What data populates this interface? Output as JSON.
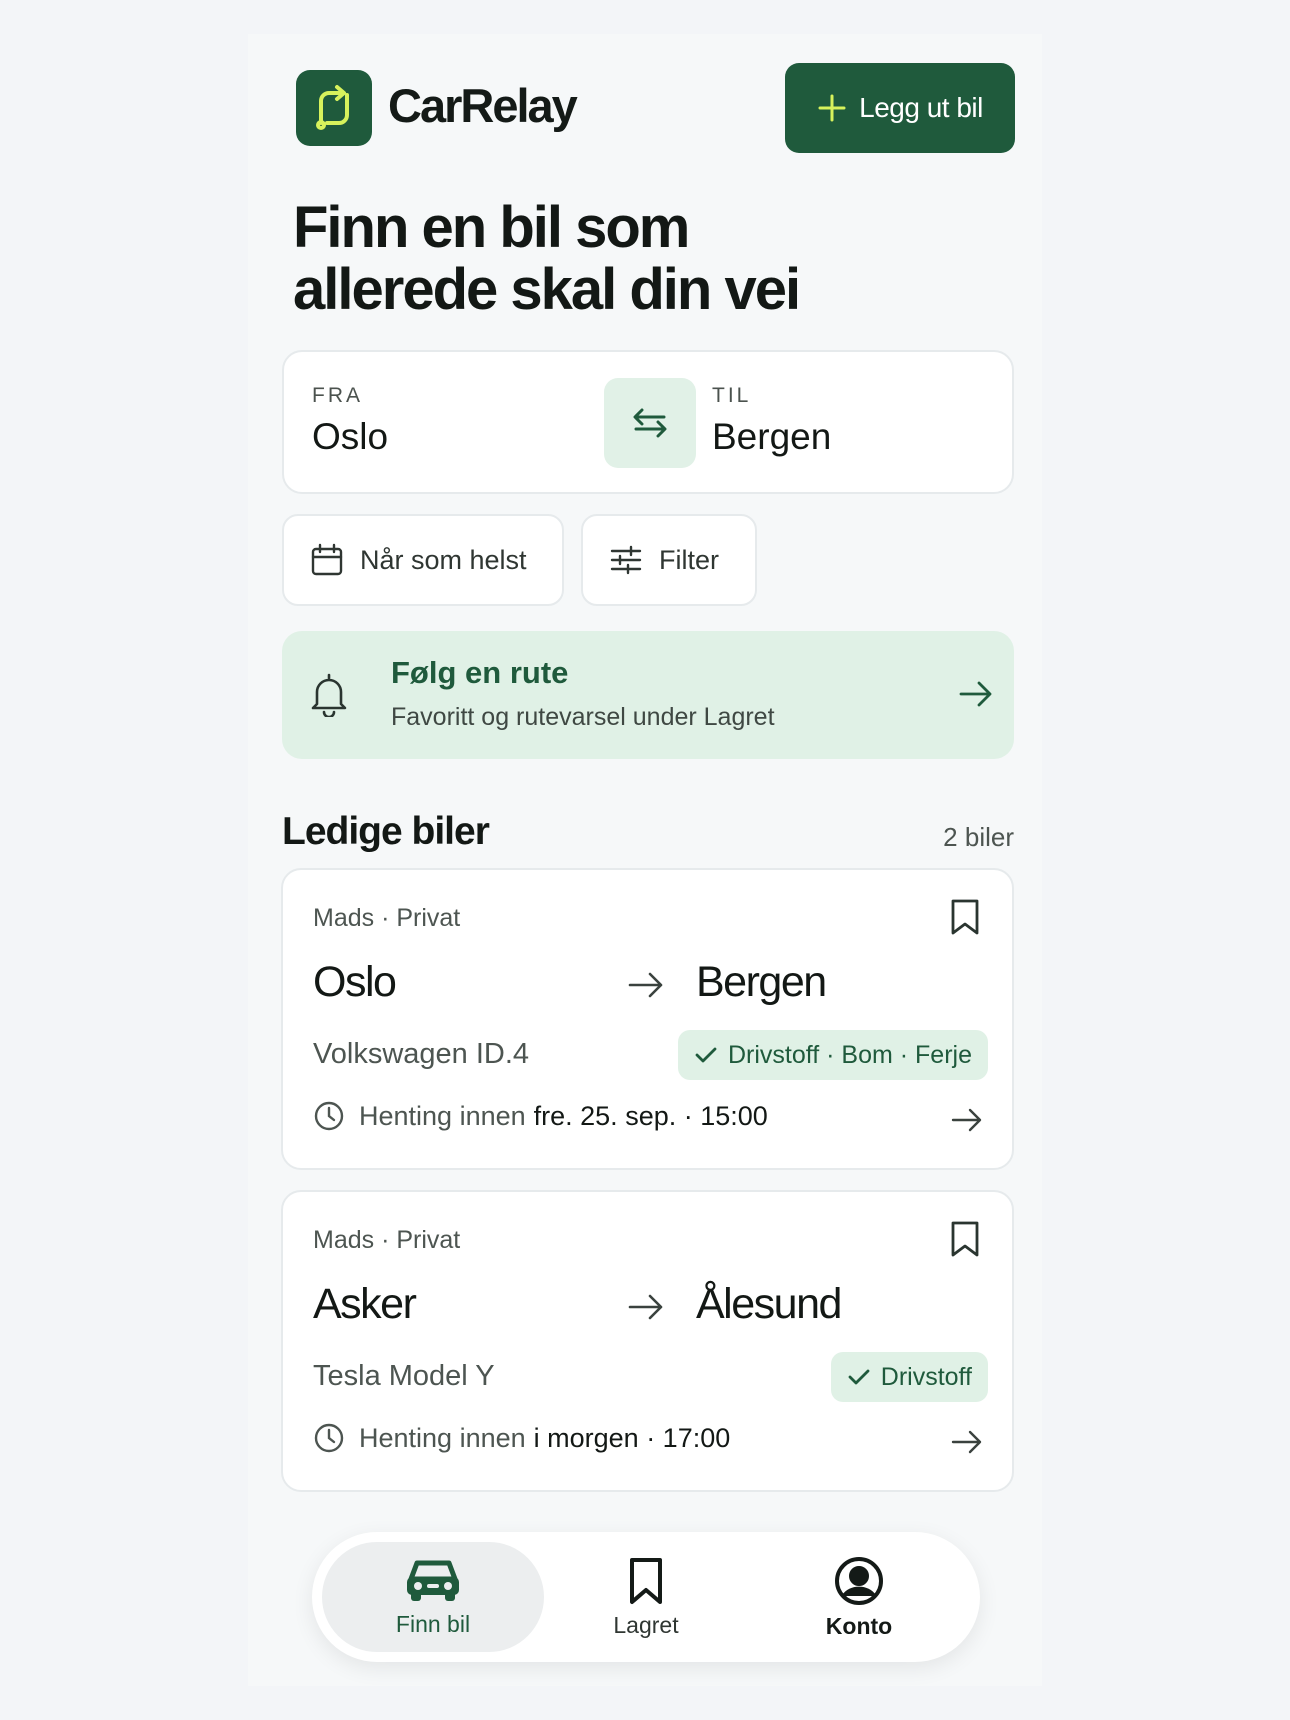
{
  "app": {
    "name": "CarRelay",
    "post_button": "Legg ut bil",
    "accent": "#1f5a3c",
    "accent_soft": "#e0f1e6",
    "icon_accent": "#d7f25c"
  },
  "hero": {
    "line1": "Finn en bil som",
    "line2": "allerede skal din vei"
  },
  "search": {
    "from_label": "FRA",
    "from_value": "Oslo",
    "to_label": "TIL",
    "to_value": "Bergen",
    "swap_icon": "swap-arrows-icon"
  },
  "chips": {
    "when": "Når som helst",
    "filter": "Filter"
  },
  "follow": {
    "title": "Følg en rute",
    "subtitle": "Favoritt og rutevarsel under Lagret"
  },
  "section": {
    "title": "Ledige biler",
    "count": "2 biler"
  },
  "listings": [
    {
      "owner": "Mads · Privat",
      "from": "Oslo",
      "to": "Bergen",
      "car": "Volkswagen ID.4",
      "badge": "Drivstoff · Bom · Ferje",
      "pickup_prefix": "Henting innen",
      "pickup_time": "fre. 25. sep. · 15:00"
    },
    {
      "owner": "Mads · Privat",
      "from": "Asker",
      "to": "Ålesund",
      "car": "Tesla Model Y",
      "badge": "Drivstoff",
      "pickup_prefix": "Henting innen",
      "pickup_time": "i morgen · 17:00"
    }
  ],
  "nav": {
    "find": "Finn bil",
    "saved": "Lagret",
    "account": "Konto"
  }
}
